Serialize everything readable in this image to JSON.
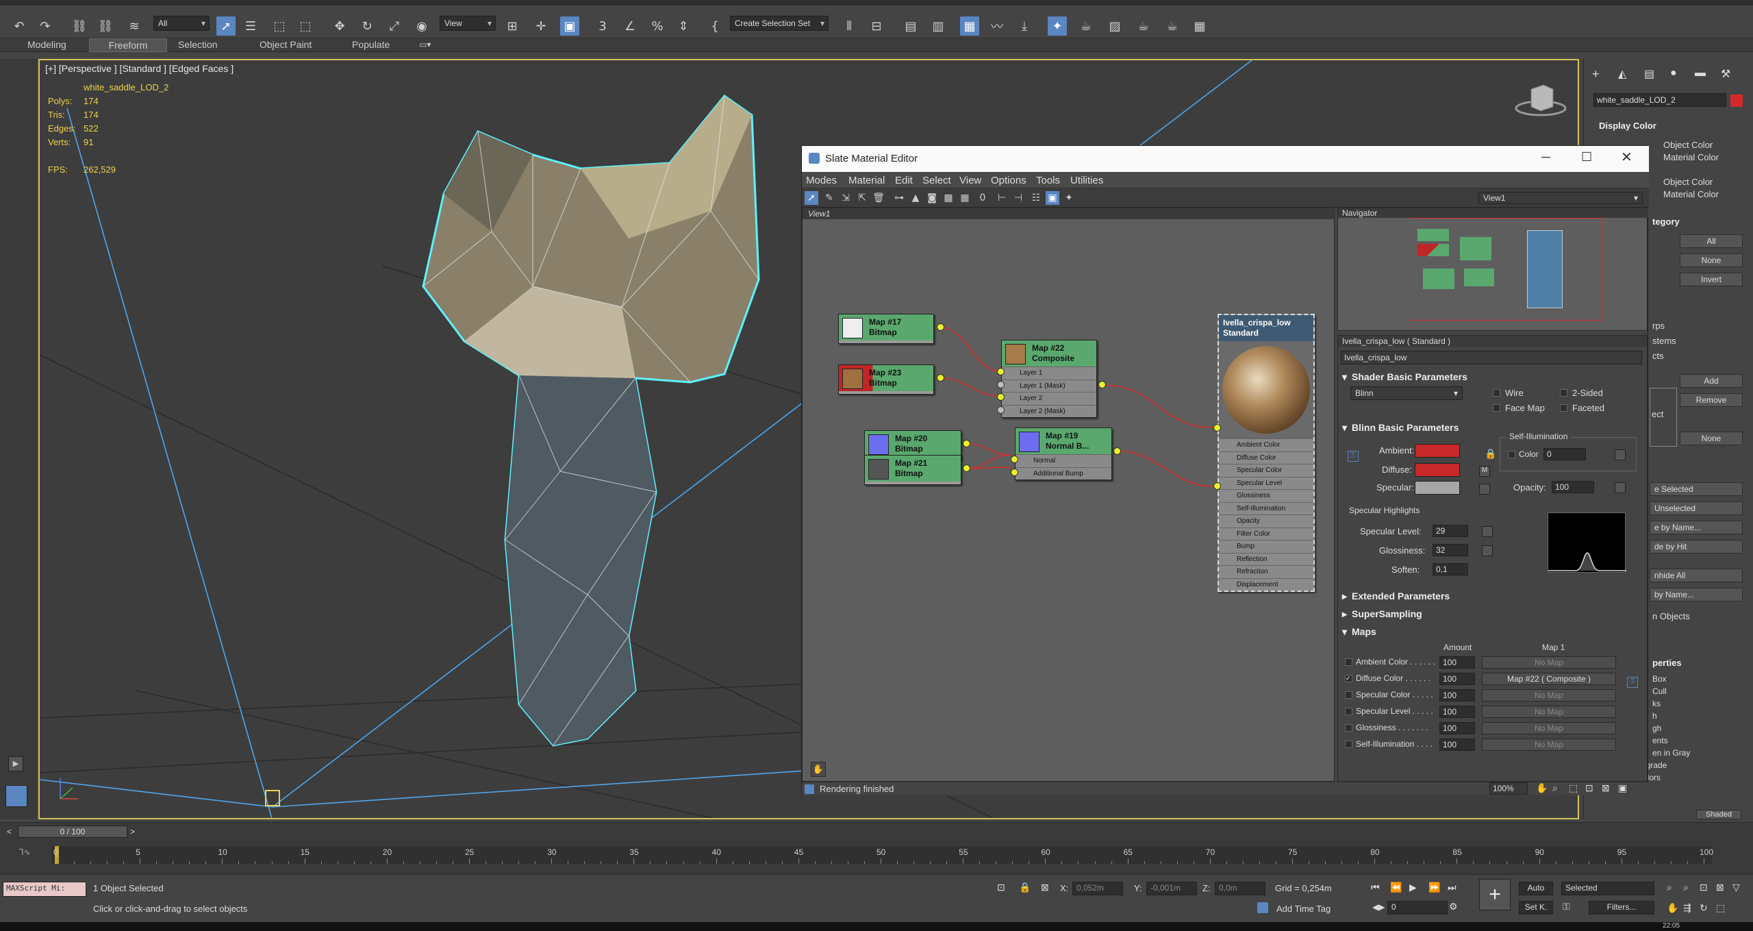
{
  "toolbar": {
    "filter_value": "All",
    "view_dropdown": "View",
    "selection_set": "Create Selection Set"
  },
  "ribbon": {
    "tabs": [
      "Modeling",
      "Freeform",
      "Selection",
      "Object Paint",
      "Populate"
    ]
  },
  "viewport": {
    "label": "[+] [Perspective ] [Standard ] [Edged Faces ]",
    "object_name": "white_saddle_LOD_2",
    "stats": [
      {
        "label": "Polys:",
        "value": "174"
      },
      {
        "label": "Tris:",
        "value": "174"
      },
      {
        "label": "Edges:",
        "value": "522"
      },
      {
        "label": "Verts:",
        "value": "91"
      }
    ],
    "fps_label": "FPS:",
    "fps_value": "262,529"
  },
  "right_panel": {
    "object_name": "white_saddle_LOD_2",
    "display_color_title": "Display Color",
    "wireframe_options": [
      "Object Color",
      "Material Color"
    ],
    "shaded_options": [
      "Object Color",
      "Material Color"
    ],
    "category_title": "tegory",
    "buttons_all": "All",
    "buttons_none": "None",
    "buttons_invert": "Invert",
    "list_items": [
      "rps",
      "stems",
      "cts"
    ],
    "add": "Add",
    "remove": "Remove",
    "ect": "ect",
    "none2": "None",
    "hide_items": [
      "e Selected",
      "Unselected",
      "e by Name...",
      "de by Hit"
    ],
    "unhide_items": [
      "nhide All",
      "by Name...",
      "n Objects"
    ],
    "properties_title": "perties",
    "props_list": [
      "Box",
      "Cull",
      "ks",
      "h",
      "gh",
      "ents"
    ],
    "gray": "en in Gray",
    "never_degrade": "Never Degrade",
    "vertex_colors": "Vertex Colors",
    "shaded_btn": "Shaded"
  },
  "sme": {
    "title": "Slate Material Editor",
    "menu": [
      "Modes",
      "Material",
      "Edit",
      "Select",
      "View",
      "Options",
      "Tools",
      "Utilities"
    ],
    "view_dropdown": "View1",
    "view_tab": "View1",
    "navigator_title": "Navigator",
    "nodes": {
      "map17": {
        "title": "Map #17",
        "type": "Bitmap"
      },
      "map23": {
        "title": "Map #23",
        "type": "Bitmap"
      },
      "map22": {
        "title": "Map #22",
        "type": "Composite",
        "slots": [
          "Layer 1",
          "Layer 1 (Mask)",
          "Layer 2",
          "Layer 2 (Mask)"
        ]
      },
      "map20": {
        "title": "Map #20",
        "type": "Bitmap"
      },
      "map21": {
        "title": "Map #21",
        "type": "Bitmap"
      },
      "map19": {
        "title": "Map #19",
        "type": "Normal B...",
        "slots": [
          "Normal",
          "Additional Bump"
        ]
      },
      "material": {
        "title": "Ivella_crispa_low",
        "type": "Standard",
        "slots": [
          "Ambient Color",
          "Diffuse Color",
          "Specular Color",
          "Specular Level",
          "Glossiness",
          "Self-Illumination",
          "Opacity",
          "Filter Color",
          "Bump",
          "Reflection",
          "Refraction",
          "Displacement"
        ]
      }
    },
    "props": {
      "header": "Ivella_crispa_low  ( Standard )",
      "name_field": "Ivella_crispa_low",
      "shader_rollout": "Shader Basic Parameters",
      "shader_value": "Blinn",
      "shader_checks": [
        "Wire",
        "2-Sided",
        "Face Map",
        "Faceted"
      ],
      "blinn_rollout": "Blinn Basic Parameters",
      "ambient": "Ambient:",
      "diffuse": "Diffuse:",
      "specular": "Specular:",
      "m_label": "M",
      "self_illum_title": "Self-Illumination",
      "color_label": "Color",
      "color_value": "0",
      "opacity_label": "Opacity:",
      "opacity_value": "100",
      "spec_highlights": "Specular Highlights",
      "spec_level_label": "Specular Level:",
      "spec_level_value": "29",
      "gloss_label": "Glossiness:",
      "gloss_value": "32",
      "soften_label": "Soften:",
      "soften_value": "0,1",
      "extended": "Extended Parameters",
      "supersampling": "SuperSampling",
      "maps": "Maps",
      "amount_header": "Amount",
      "map1_header": "Map 1",
      "map_rows": [
        {
          "name": "Ambient Color . . . . . .",
          "amount": "100",
          "map": "No Map",
          "checked": false
        },
        {
          "name": "Diffuse Color . . . . . .",
          "amount": "100",
          "map": "Map #22  ( Composite )",
          "checked": true
        },
        {
          "name": "Specular Color . . . . .",
          "amount": "100",
          "map": "No Map",
          "checked": false
        },
        {
          "name": "Specular Level . . . . .",
          "amount": "100",
          "map": "No Map",
          "checked": false
        },
        {
          "name": "Glossiness . . . . . . .",
          "amount": "100",
          "map": "No Map",
          "checked": false
        },
        {
          "name": "Self-Illumination . . . .",
          "amount": "100",
          "map": "No Map",
          "checked": false
        }
      ]
    },
    "status": "Rendering finished",
    "zoom": "100%",
    "colors": {
      "ambient": "#c8282a",
      "diffuse": "#c8282a",
      "specular": "#a6a6a6",
      "node_header": "#5aa86e"
    }
  },
  "timeline": {
    "frame_counter": "0 / 100",
    "ticks": [
      "0",
      "5",
      "10",
      "15",
      "20",
      "25",
      "30",
      "35",
      "40",
      "45",
      "50",
      "55",
      "60",
      "65",
      "70",
      "75",
      "80",
      "85",
      "90",
      "95",
      "100"
    ]
  },
  "status": {
    "maxscript": "MAXScript Mi:",
    "objects_selected": "1 Object Selected",
    "prompt": "Click or click-and-drag to select objects",
    "x_label": "X:",
    "x_value": "0,052m",
    "y_label": "Y:",
    "y_value": "-0,001m",
    "z_label": "Z:",
    "z_value": "0,0m",
    "grid": "Grid = 0,254m",
    "add_time_tag": "Add Time Tag",
    "auto": "Auto",
    "set_k": "Set K.",
    "selected": "Selected",
    "filters": "Filters...",
    "frame_field": "0",
    "clock": "22:05"
  }
}
